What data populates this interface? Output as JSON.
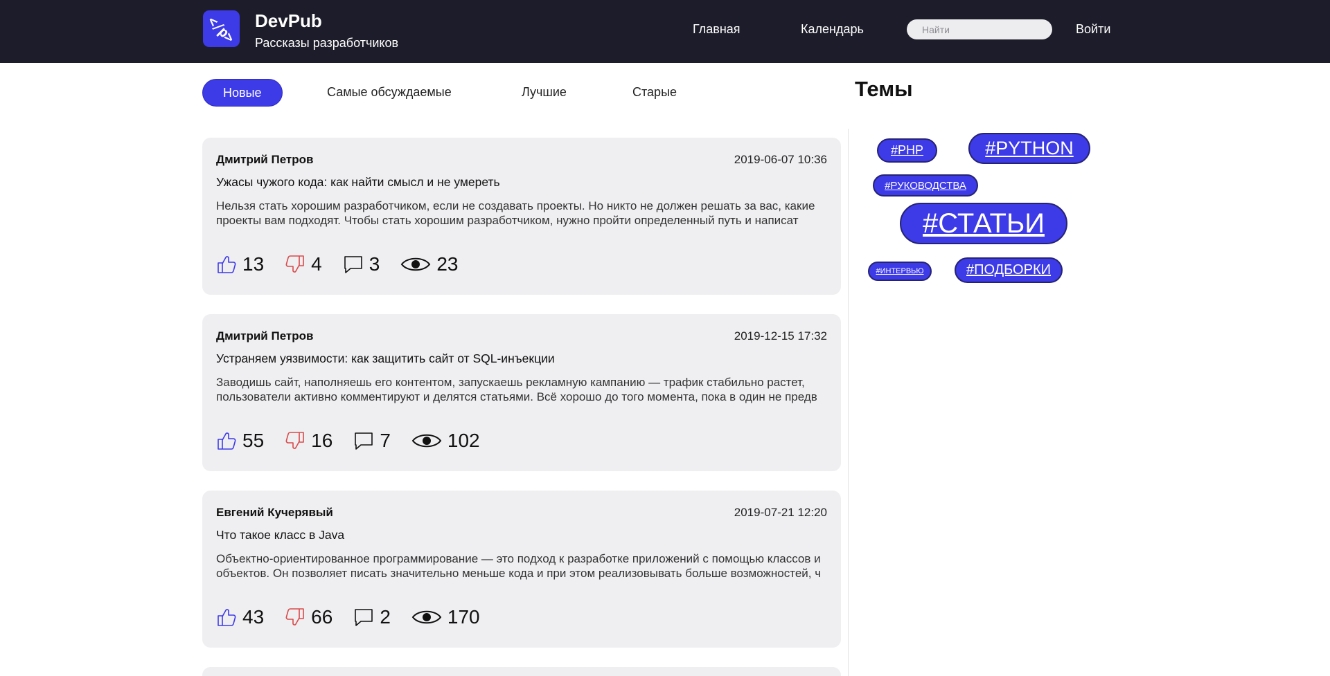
{
  "header": {
    "logo_text": "</p>",
    "brand": "DevPub",
    "subtitle": "Рассказы разработчиков",
    "nav": [
      "Главная",
      "Календарь"
    ],
    "search_placeholder": "Найти",
    "login": "Войти"
  },
  "tabs": [
    "Новые",
    "Самые обсуждаемые",
    "Лучшие",
    "Старые"
  ],
  "active_tab": "Новые",
  "sidebar": {
    "title": "Темы",
    "tags": [
      "#PHP",
      "#PYTHON",
      "#РУКОВОДСТВА",
      "#СТАТЬИ",
      "#ИНТЕРВЬЮ",
      "#ПОДБОРКИ"
    ]
  },
  "colors": {
    "accent": "#3d3ae8",
    "header_bg": "#1d1c2a",
    "card_bg": "#efeef1",
    "dislike": "#d84a4a"
  },
  "posts": [
    {
      "author": "Дмитрий Петров",
      "date": "2019-06-07 10:36",
      "title": "Ужасы чужого кода: как найти смысл и не умереть",
      "excerpt": "Нельзя стать хорошим разработчиком, если не создавать проекты. Но никто не должен решать за вас, какие проекты вам подходят. Чтобы стать хорошим разработчиком, нужно пройти определенный путь и написат",
      "likes": "13",
      "dislikes": "4",
      "comments": "3",
      "views": "23"
    },
    {
      "author": "Дмитрий Петров",
      "date": "2019-12-15 17:32",
      "title": "Устраняем уязвимости: как защитить сайт от SQL-инъекции",
      "excerpt": "Заводишь сайт, наполняешь его контентом, запускаешь рекламную кампанию — трафик стабильно растет, пользователи активно комментируют и делятся статьями. Всё хорошо до того момента, пока в один не предв",
      "likes": "55",
      "dislikes": "16",
      "comments": "7",
      "views": "102"
    },
    {
      "author": "Евгений Кучерявый",
      "date": "2019-07-21 12:20",
      "title": "Что такое класс в Java",
      "excerpt": "Объектно-ориентированное программирование — это подход к разработке приложений с помощью классов и объектов. Он позволяет писать значительно меньше кода и при этом реализовывать больше возможностей, ч",
      "likes": "43",
      "dislikes": "66",
      "comments": "2",
      "views": "170"
    }
  ]
}
